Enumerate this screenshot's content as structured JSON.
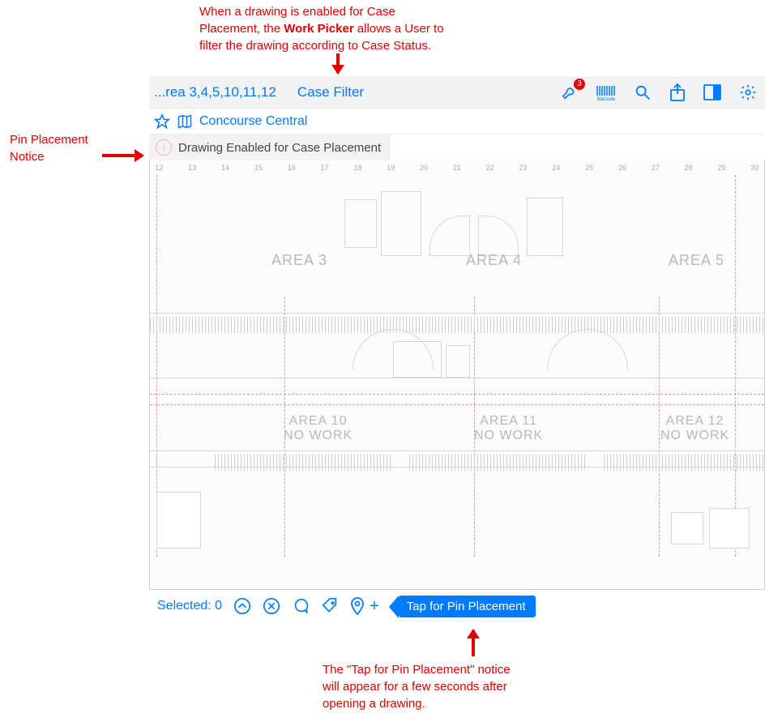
{
  "annotations": {
    "top": {
      "line1": "When a drawing is enabled for Case",
      "line2_pre": "Placement, the ",
      "line2_bold": "Work Picker",
      "line2_post": " allows a User to",
      "line3": "filter the drawing according to Case Status."
    },
    "left": {
      "line1": "Pin Placement",
      "line2": "Notice"
    },
    "bottom": {
      "line1": "The \"Tap for Pin Placement\" notice",
      "line2": "will appear for a few seconds after",
      "line3": "opening a drawing."
    }
  },
  "toolbar": {
    "back_label": "...rea 3,4,5,10,11,12",
    "case_filter": "Case Filter",
    "badge_count": "3",
    "barcode_label": "Barcode"
  },
  "subheader": {
    "drawing_title": "Concourse Central"
  },
  "notice": {
    "i": "i",
    "text": "Drawing Enabled for Case Placement"
  },
  "canvas": {
    "ruler": [
      "12",
      "13",
      "14",
      "15",
      "16",
      "17",
      "18",
      "19",
      "20",
      "21",
      "22",
      "23",
      "24",
      "25",
      "26",
      "27",
      "28",
      "29",
      "30"
    ],
    "areas": {
      "a3": "AREA 3",
      "a4": "AREA 4",
      "a5": "AREA 5",
      "a10_t": "AREA 10",
      "a10_s": "NO WORK",
      "a11_t": "AREA 11",
      "a11_s": "NO WORK",
      "a12_t": "AREA 12",
      "a12_s": "NO WORK"
    }
  },
  "footer": {
    "selected_label": "Selected: 0",
    "plus": "+",
    "callout": "Tap for Pin Placement"
  }
}
